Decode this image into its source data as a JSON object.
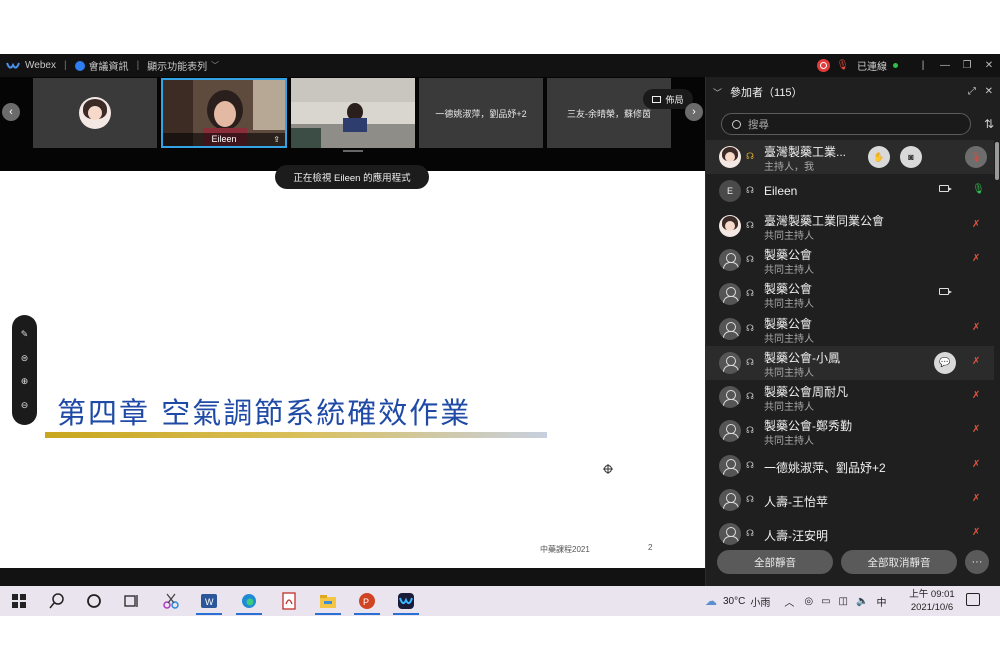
{
  "app": {
    "name": "Webex",
    "meeting_info": "會議資訊",
    "menu_toggle": "顯示功能表列",
    "connection_status": "已連線",
    "window_controls": [
      "|",
      "—",
      "❐",
      "✕"
    ]
  },
  "video_strip": {
    "tiles": [
      {
        "label": "",
        "kind": "avatar"
      },
      {
        "label": "Eileen",
        "kind": "video-active"
      },
      {
        "label": "",
        "kind": "video"
      },
      {
        "label": "一德姚淑萍，劉品妤+2",
        "kind": "text"
      },
      {
        "label": "三友-余晴榮，蘇修茵",
        "kind": "text"
      }
    ],
    "layout_button": "佈局",
    "nav_prev": "‹",
    "nav_next": "›"
  },
  "viewing_label": "正在檢視 Eileen 的應用程式",
  "slide": {
    "title": "第四章  空氣調節系統確效作業",
    "footer": "中藥課程2021",
    "page_number": "2"
  },
  "annotation_toolbar": {
    "tools": [
      "✎",
      "⊜",
      "⊕",
      "⊖"
    ]
  },
  "participants": {
    "header": "參加者（115）",
    "header_controls": [
      "⤢",
      "✕"
    ],
    "search_placeholder": "搜尋",
    "sort_icon": "⇅",
    "rows": [
      {
        "name": "臺灣製藥工業...",
        "role": "主持人，我",
        "avatar": "cartoon",
        "mic": "muted",
        "highlight": true,
        "buttons": [
          "✋",
          "◙"
        ]
      },
      {
        "name": "Eileen",
        "role": "",
        "avatar": "letter",
        "avatar_letter": "E",
        "mic": "on",
        "camera": true
      },
      {
        "name": "臺灣製藥工業同業公會",
        "role": "共同主持人",
        "avatar": "cartoon",
        "mic": "muted"
      },
      {
        "name": "製藥公會",
        "role": "共同主持人",
        "avatar": "person",
        "mic": "muted"
      },
      {
        "name": "製藥公會",
        "role": "共同主持人",
        "avatar": "person",
        "mic": "none",
        "camera": true
      },
      {
        "name": "製藥公會",
        "role": "共同主持人",
        "avatar": "person",
        "mic": "muted"
      },
      {
        "name": "製藥公會-小鳳",
        "role": "共同主持人",
        "avatar": "person",
        "mic": "muted",
        "highlight": true,
        "chat": "💬"
      },
      {
        "name": "製藥公會周耐凡",
        "role": "共同主持人",
        "avatar": "person",
        "mic": "muted"
      },
      {
        "name": "製藥公會-鄭秀勤",
        "role": "共同主持人",
        "avatar": "person",
        "mic": "muted"
      },
      {
        "name": "一德姚淑萍、劉品妤+2",
        "role": "",
        "avatar": "person",
        "mic": "muted"
      },
      {
        "name": "人壽-王怡苹",
        "role": "",
        "avatar": "person",
        "mic": "muted"
      },
      {
        "name": "人壽-汪安明",
        "role": "",
        "avatar": "person",
        "mic": "muted"
      }
    ],
    "mute_all": "全部靜音",
    "unmute_all": "全部取消靜音",
    "more": "···"
  },
  "taskbar": {
    "weather_temp": "30°C",
    "weather_desc": "小雨",
    "ime": "中",
    "time": "上午 09:01",
    "date": "2021/10/6",
    "icons": [
      "windows-start",
      "search",
      "cortana",
      "task-view",
      "snipping",
      "word",
      "edge",
      "pdf",
      "file-explorer",
      "powerpoint",
      "webex"
    ]
  },
  "colors": {
    "accent": "#33a3e6",
    "muted_red": "#e0533e",
    "connected_green": "#2fbf4a",
    "slide_title": "#1f4aa6"
  }
}
